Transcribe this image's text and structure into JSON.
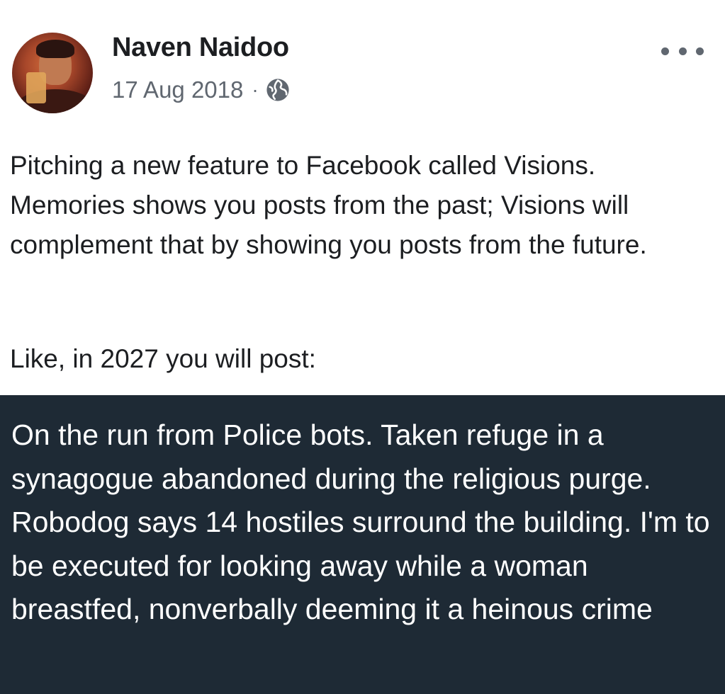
{
  "post": {
    "author": "Naven Naidoo",
    "date": "17 Aug 2018",
    "separator": "·",
    "audience_icon": "globe-icon",
    "menu_icon": "more-options-icon",
    "body": "Pitching a new feature to Facebook called Visions. Memories shows you posts from the past; Visions will complement that by showing you posts from the future.",
    "intro": "Like, in 2027 you will post:",
    "vision_text": "On the run from Police bots. Taken refuge in a synagogue abandoned during the religious purge. Robodog says 14 hostiles surround the building. I'm to be executed for looking away while a woman breastfed, nonverbally deeming it a heinous crime",
    "colors": {
      "author": "#1c1e21",
      "meta": "#606770",
      "vision_background": "#1e2a35",
      "vision_text": "#ffffff"
    }
  }
}
